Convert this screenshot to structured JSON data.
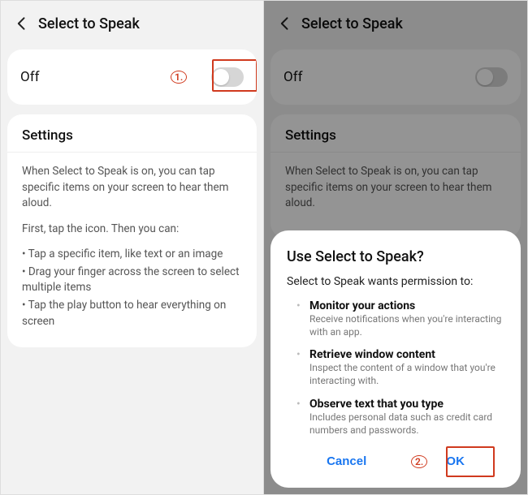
{
  "left": {
    "header": {
      "title": "Select to Speak"
    },
    "toggle": {
      "label": "Off",
      "on": false
    },
    "settings_heading": "Settings",
    "desc_p1": "When Select to Speak is on, you can tap specific items on your screen to hear them aloud.",
    "desc_p2": "First, tap the icon. Then you can:",
    "bullets": [
      "Tap a specific item, like text or an image",
      "Drag your finger across the screen to select multiple items",
      "Tap the play button to hear everything on screen"
    ],
    "callout": "1."
  },
  "right": {
    "header": {
      "title": "Select to Speak"
    },
    "toggle": {
      "label": "Off"
    },
    "settings_heading": "Settings",
    "desc_p1": "When Select to Speak is on, you can tap specific items on your screen to hear them aloud.",
    "dialog": {
      "title": "Use Select to Speak?",
      "subtitle": "Select to Speak wants permission to:",
      "perms": [
        {
          "title": "Monitor your actions",
          "desc": "Receive notifications when you're interacting with an app."
        },
        {
          "title": "Retrieve window content",
          "desc": "Inspect the content of a window that you're interacting with."
        },
        {
          "title": "Observe text that you type",
          "desc": "Includes personal data such as credit card numbers and passwords."
        }
      ],
      "cancel": "Cancel",
      "ok": "OK"
    },
    "callout": "2."
  }
}
